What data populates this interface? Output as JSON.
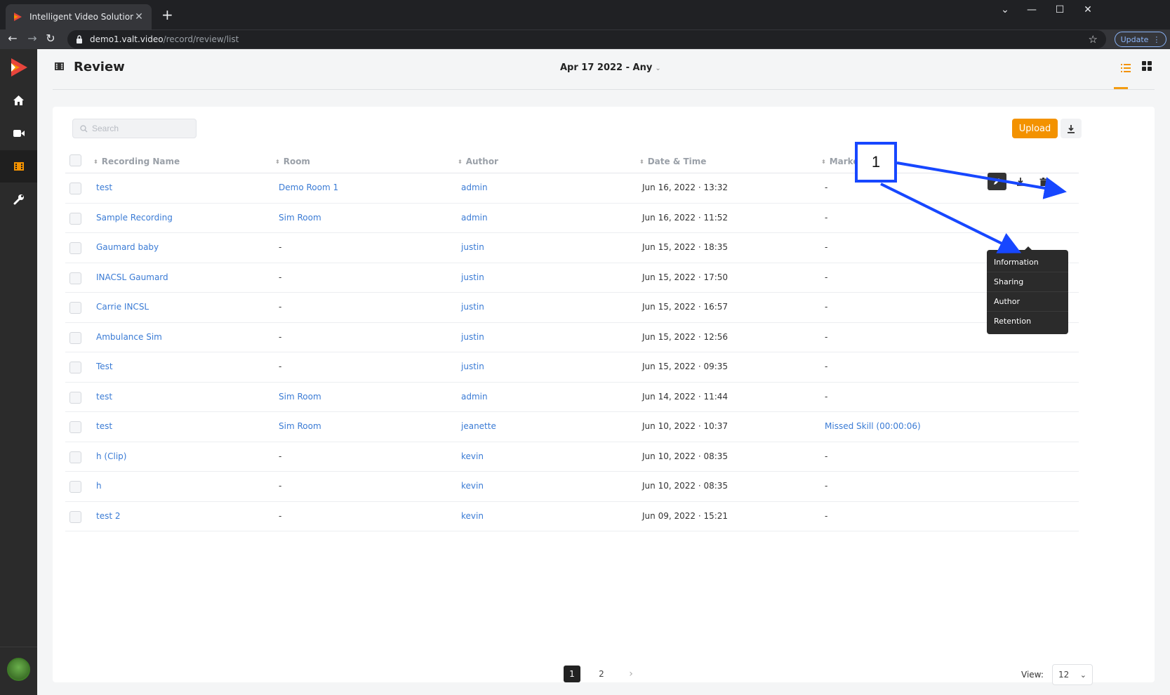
{
  "browser": {
    "tab_title": "Intelligent Video Solutions",
    "url_host": "demo1.valt.video",
    "url_path": "/record/review/list",
    "update_label": "Update"
  },
  "header": {
    "title": "Review",
    "date_filter": "Apr 17 2022 - Any"
  },
  "toolbar": {
    "search_placeholder": "Search",
    "upload_label": "Upload"
  },
  "table": {
    "columns": [
      "Recording Name",
      "Room",
      "Author",
      "Date & Time",
      "Marke"
    ],
    "rows": [
      {
        "name": "test",
        "room": "Demo Room 1",
        "author": "admin",
        "datetime": "Jun 16, 2022 · 13:32",
        "markers": "-"
      },
      {
        "name": "Sample Recording",
        "room": "Sim Room",
        "author": "admin",
        "datetime": "Jun 16, 2022 · 11:52",
        "markers": "-"
      },
      {
        "name": "Gaumard baby",
        "room": "-",
        "author": "justin",
        "datetime": "Jun 15, 2022 · 18:35",
        "markers": "-"
      },
      {
        "name": "INACSL Gaumard",
        "room": "-",
        "author": "justin",
        "datetime": "Jun 15, 2022 · 17:50",
        "markers": "-"
      },
      {
        "name": "Carrie INCSL",
        "room": "-",
        "author": "justin",
        "datetime": "Jun 15, 2022 · 16:57",
        "markers": "-"
      },
      {
        "name": "Ambulance Sim",
        "room": "-",
        "author": "justin",
        "datetime": "Jun 15, 2022 · 12:56",
        "markers": "-"
      },
      {
        "name": "Test",
        "room": "-",
        "author": "justin",
        "datetime": "Jun 15, 2022 · 09:35",
        "markers": "-"
      },
      {
        "name": "test",
        "room": "Sim Room",
        "author": "admin",
        "datetime": "Jun 14, 2022 · 11:44",
        "markers": "-"
      },
      {
        "name": "test",
        "room": "Sim Room",
        "author": "jeanette",
        "datetime": "Jun 10, 2022 · 10:37",
        "markers": "Missed Skill (00:00:06)"
      },
      {
        "name": "h (Clip)",
        "room": "-",
        "author": "kevin",
        "datetime": "Jun 10, 2022 · 08:35",
        "markers": "-"
      },
      {
        "name": "h",
        "room": "-",
        "author": "kevin",
        "datetime": "Jun 10, 2022 · 08:35",
        "markers": "-"
      },
      {
        "name": "test 2",
        "room": "-",
        "author": "kevin",
        "datetime": "Jun 09, 2022 · 15:21",
        "markers": "-"
      }
    ]
  },
  "edit_menu": {
    "items": [
      "Information",
      "Sharing",
      "Author",
      "Retention"
    ]
  },
  "annotation": {
    "label": "1",
    "color": "#1747ff"
  },
  "pagination": {
    "pages": [
      "1",
      "2"
    ],
    "current": "1",
    "view_label": "View:",
    "view_value": "12"
  },
  "colors": {
    "accent": "#f39200",
    "link": "#3a7bd5",
    "sidebar": "#2b2b2b"
  },
  "icons": {
    "sidebar": [
      "home-icon",
      "camera-icon",
      "film-icon",
      "wrench-icon"
    ],
    "row_actions": [
      "pencil-icon",
      "download-icon",
      "trash-icon"
    ]
  }
}
